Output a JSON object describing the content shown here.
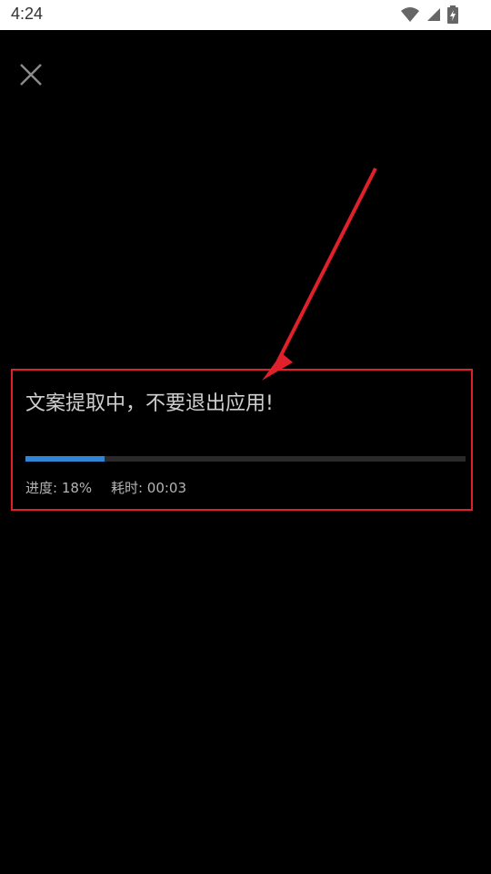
{
  "status_bar": {
    "time": "4:24",
    "icons": [
      "wifi-icon",
      "signal-icon",
      "battery-icon"
    ]
  },
  "close_icon": "close-icon",
  "progress": {
    "title": "文案提取中，不要退出应用!",
    "progress_label": "进度: 18%",
    "progress_value": 0.18,
    "elapsed_label": "耗时: 00:03"
  },
  "annotation": {
    "color": "#e0202a"
  },
  "colors": {
    "background": "#000000",
    "progress_fill": "#2f86d6",
    "progress_track": "#2a2a2a",
    "highlight_border": "#e0202a"
  }
}
